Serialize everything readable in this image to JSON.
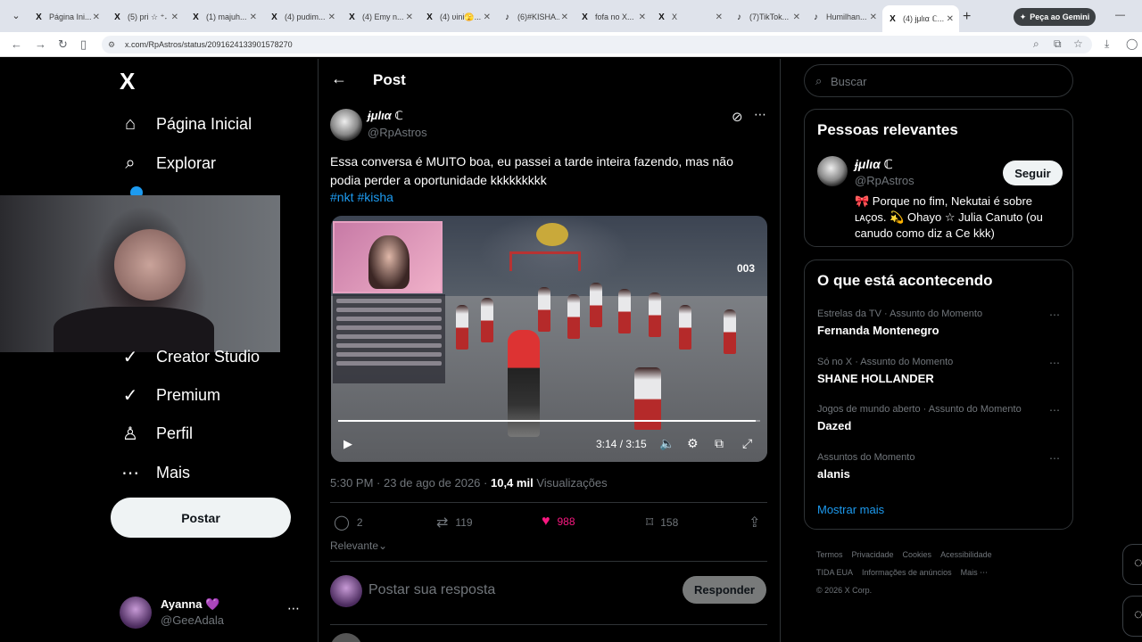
{
  "browser": {
    "tabs": [
      {
        "icon": "X",
        "title": "Página Ini..."
      },
      {
        "icon": "X",
        "title": "(5) pri ☆ ⁺˖ ..."
      },
      {
        "icon": "X",
        "title": "(1) majuh..."
      },
      {
        "icon": "X",
        "title": "(4) pudim..."
      },
      {
        "icon": "X",
        "title": "(4) Emy n..."
      },
      {
        "icon": "X",
        "title": "(4) ʋini🫣..."
      },
      {
        "icon": "♪",
        "title": "(6)#KISHA..."
      },
      {
        "icon": "X",
        "title": "fofa no X..."
      },
      {
        "icon": "X",
        "title": "X"
      },
      {
        "icon": "♪",
        "title": "(7)TikTok..."
      },
      {
        "icon": "♪",
        "title": "Humilhan..."
      },
      {
        "icon": "X",
        "title": "(4) ɉμlια ℂ..."
      }
    ],
    "gemini_label": "Peça ao Gemini",
    "url": "x.com/RpAstros/status/2091624133901578270"
  },
  "sidebar": {
    "logo": "X",
    "items": [
      {
        "icon": "⌂",
        "label": "Página Inicial"
      },
      {
        "icon": "⌕",
        "label": "Explorar"
      },
      {
        "icon": "✓",
        "label": "Creator Studio"
      },
      {
        "icon": "✓",
        "label": "Premium"
      },
      {
        "icon": "♙",
        "label": "Perfil"
      },
      {
        "icon": "⋯",
        "label": "Mais"
      }
    ],
    "post_button": "Postar",
    "account": {
      "name": "Ayanna 💜",
      "handle": "@GeeAdala",
      "more": "⋯"
    }
  },
  "main": {
    "header": "Post",
    "post": {
      "name": "ɉμlια ℂ",
      "handle": "@RpAstros",
      "text": "Essa conversa é MUITO boa, eu passei a tarde inteira fazendo, mas não podia perder a oportunidade kkkkkkkkk",
      "hashtags": [
        "#nkt",
        "#kisha"
      ],
      "video": {
        "counter": "003",
        "time": "3:14 / 3:15",
        "progress": 0.99
      },
      "time": "5:30 PM · 23 de ago de 2026 ·",
      "views_count": "10,4 mil",
      "views_label": "Visualizações",
      "replies": "2",
      "reposts": "119",
      "likes": "988",
      "bookmarks": "158"
    },
    "sort_label": "Relevante",
    "reply_placeholder": "Postar sua resposta",
    "reply_button": "Responder"
  },
  "right": {
    "search_placeholder": "Buscar",
    "relevant": {
      "title": "Pessoas relevantes",
      "name": "ɉμlια ℂ",
      "handle": "@RpAstros",
      "bio": "🎀 Porque no fim, Nekutai é sobre ʟᴀçᴏs. 💫 Ohayo ☆ Julia Canuto (ou canudo como diz a Ce kkk)",
      "follow": "Seguir"
    },
    "trending": {
      "title": "O que está acontecendo",
      "items": [
        {
          "context": "Estrelas da TV · Assunto do Momento",
          "name": "Fernanda Montenegro"
        },
        {
          "context": "Só no X · Assunto do Momento",
          "name": "SHANE HOLLANDER"
        },
        {
          "context": "Jogos de mundo aberto · Assunto do Momento",
          "name": "Dazed"
        },
        {
          "context": "Assuntos do Momento",
          "name": "alanis"
        }
      ],
      "show_more": "Mostrar mais"
    },
    "footer": {
      "line1": [
        "Termos",
        "Privacidade",
        "Cookies",
        "Acessibilidade"
      ],
      "line2": [
        "TIDA EUA",
        "Informações de anúncios",
        "Mais ⋯"
      ],
      "copyright": "© 2026 X Corp."
    }
  }
}
